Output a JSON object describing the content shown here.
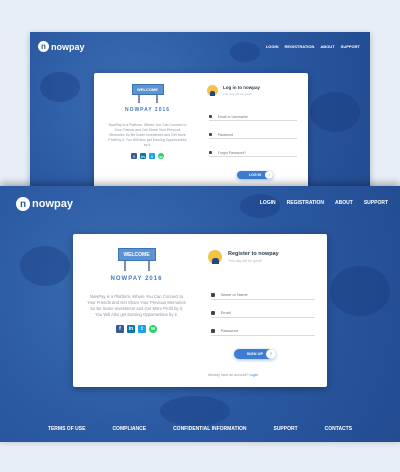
{
  "login_page": {
    "logo_text": "nowpay",
    "nav": [
      "LOGIN",
      "REGISTRATION",
      "ABOUT",
      "SUPPORT"
    ],
    "sign_text": "WELCOME",
    "brand_title": "NOWPAY 2016",
    "description": "NowPay is a Platform, Where You Can Connect to Your Friends and Get Share Your Previous Memories So Be Some Investment and Get More Profit by it. You Will Also get Earning Opportunities by it.",
    "form_title": "Log in to nowpay",
    "form_subtitle": "This day will be great!",
    "fields": [
      {
        "icon": "user-icon",
        "placeholder": "Email or Username"
      },
      {
        "icon": "lock-icon",
        "placeholder": "Password"
      },
      {
        "icon": "lock-icon",
        "placeholder": "Forgot Password?"
      }
    ],
    "button_label": "LOG IN"
  },
  "register_page": {
    "logo_text": "nowpay",
    "nav": [
      "LOGIN",
      "REGISTRATION",
      "ABOUT",
      "SUPPORT"
    ],
    "sign_text": "WELCOME",
    "brand_title": "NOWPAY 2016",
    "description": "NowPay is a Platform, Where You Can Connect to Your Friends and Get Share Your Previous Memories So Be Some Investment and Get More Profit by it. You Will Also get Earning Opportunities by it.",
    "form_title": "Register to nowpay",
    "form_subtitle": "This day will be great!",
    "fields": [
      {
        "icon": "user-icon",
        "placeholder": "Name or Name"
      },
      {
        "icon": "mail-icon",
        "placeholder": "Email"
      },
      {
        "icon": "lock-icon",
        "placeholder": "Password"
      }
    ],
    "button_label": "SIGN UP",
    "already_text": "Already have an account?",
    "already_link": "Login",
    "footer": [
      "TERMS OF USE",
      "COMPLIANCE",
      "CONFIDENTIAL INFORMATION",
      "SUPPORT",
      "CONTACTS"
    ]
  },
  "colors": {
    "background": "#2b5aa3",
    "accent": "#3e7dd1",
    "brand_text": "#3e7ac4",
    "avatar": "#f6c343"
  }
}
